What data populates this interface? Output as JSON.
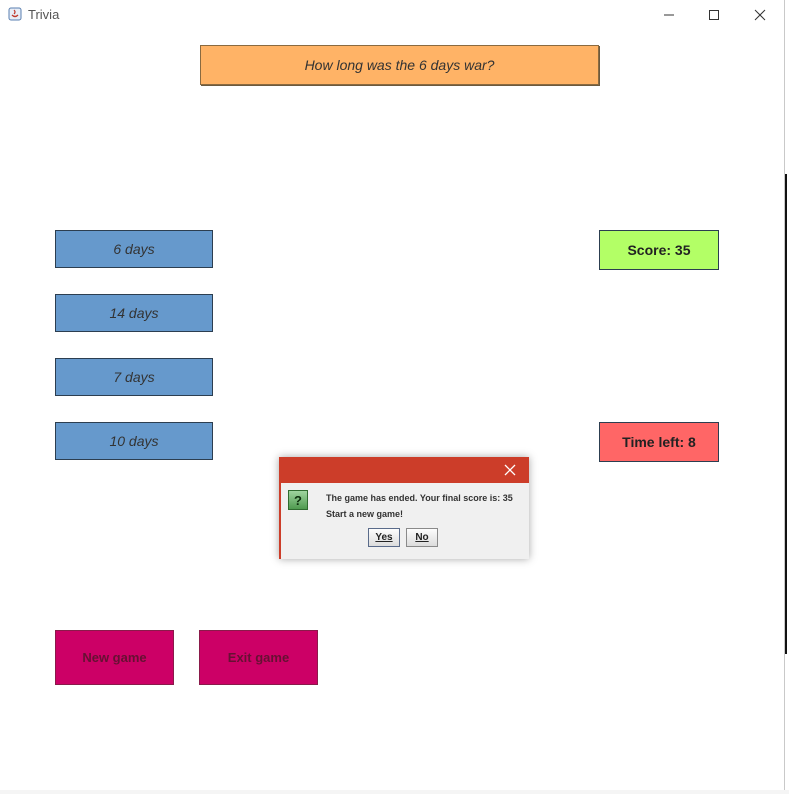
{
  "window": {
    "title": "Trivia"
  },
  "question": "How long was the 6 days war?",
  "answers": [
    "6 days",
    "14 days",
    "7 days",
    "10 days"
  ],
  "score_label": "Score: 35",
  "time_label": "Time left: 8",
  "buttons": {
    "new_game": "New game",
    "exit_game": "Exit game"
  },
  "dialog": {
    "message_line1": "The game has ended. Your final score is: 35",
    "message_line2": "Start a new game!",
    "icon_glyph": "?",
    "yes_label": "Yes",
    "no_label": "No"
  },
  "colors": {
    "question_bg": "#ffb366",
    "answer_bg": "#6699cc",
    "score_bg": "#b3ff66",
    "time_bg": "#ff6666",
    "action_btn_bg": "#cc0066",
    "dialog_titlebar": "#cc3d29"
  },
  "icons": [
    "java-app-icon",
    "minimize-icon",
    "maximize-icon",
    "close-icon",
    "question-icon",
    "dialog-close-icon"
  ]
}
